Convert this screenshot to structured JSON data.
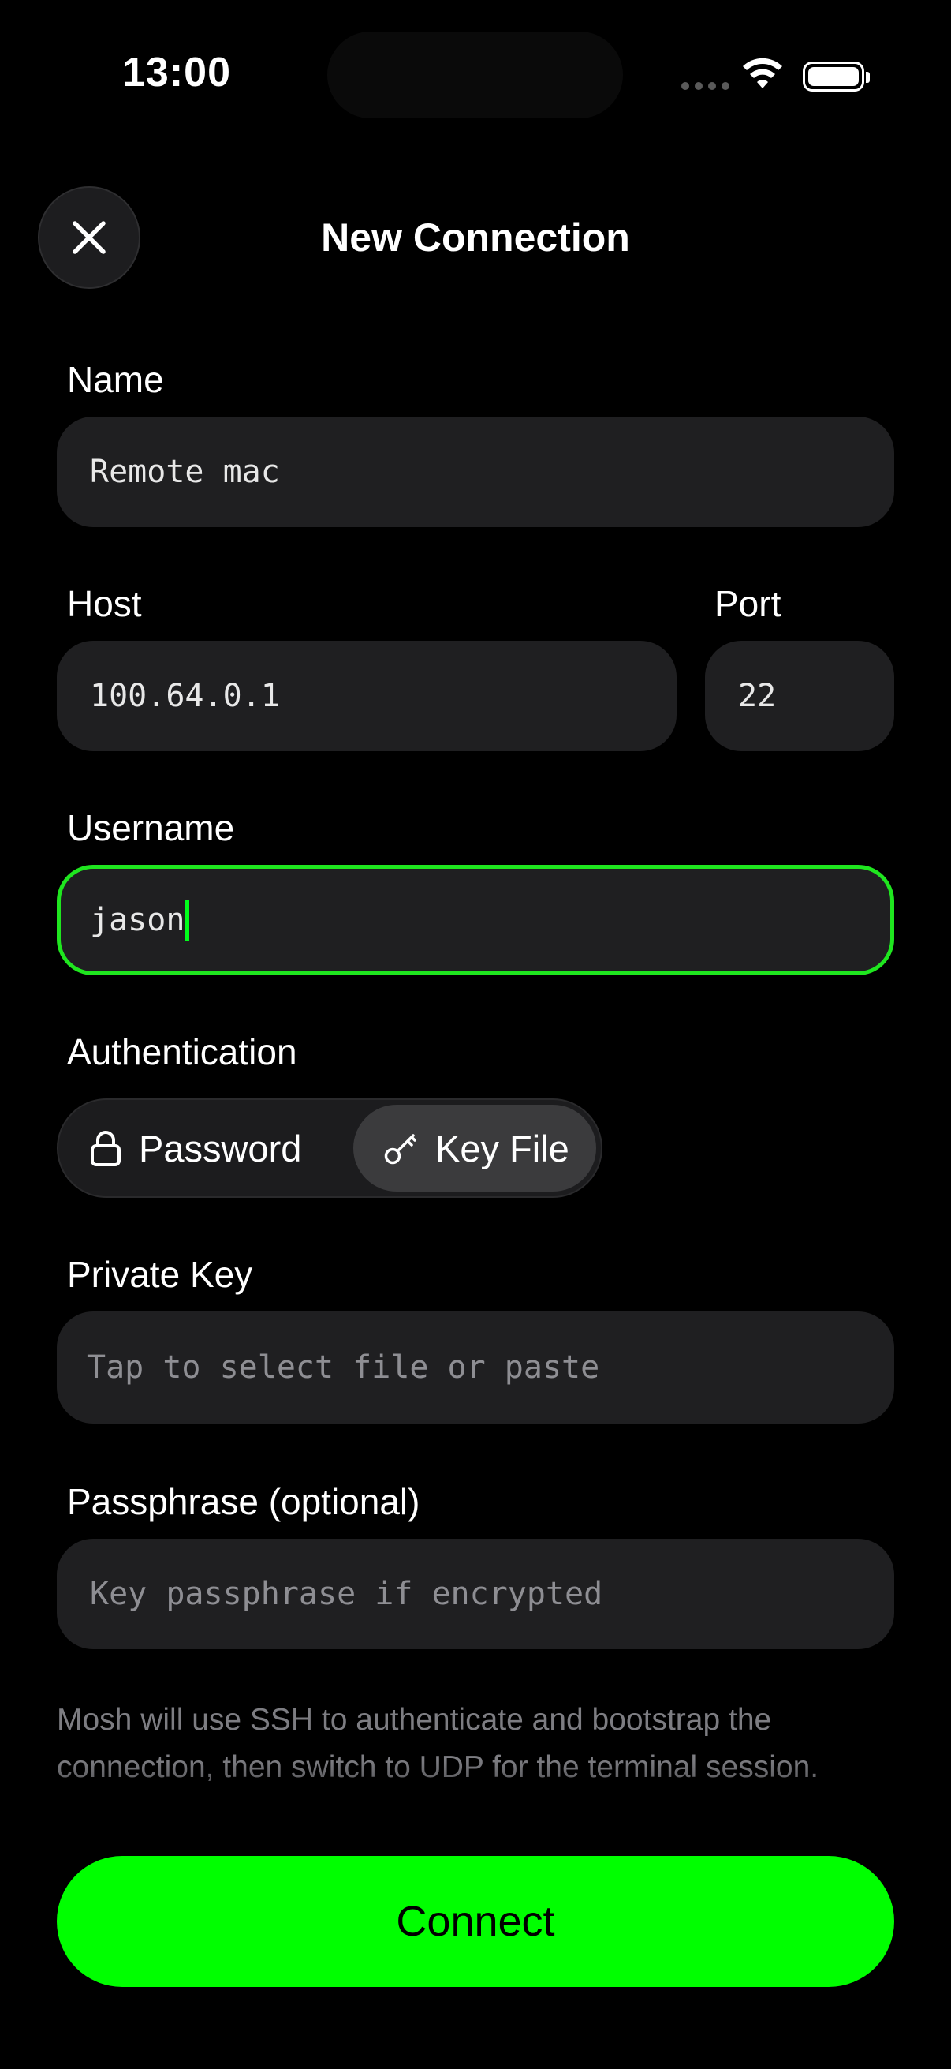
{
  "status_bar": {
    "time": "13:00"
  },
  "header": {
    "title": "New Connection",
    "close_icon": "close-icon"
  },
  "form": {
    "name": {
      "label": "Name",
      "value": "Remote mac"
    },
    "host": {
      "label": "Host",
      "value": "100.64.0.1"
    },
    "port": {
      "label": "Port",
      "value": "22"
    },
    "username": {
      "label": "Username",
      "value": "jason"
    },
    "authentication": {
      "label": "Authentication",
      "options": [
        {
          "label": "Password",
          "icon": "lock-icon",
          "selected": false
        },
        {
          "label": "Key File",
          "icon": "key-icon",
          "selected": true
        }
      ]
    },
    "private_key": {
      "label": "Private Key",
      "placeholder": "Tap to select file or paste"
    },
    "passphrase": {
      "label": "Passphrase (optional)",
      "placeholder": "Key passphrase if encrypted"
    }
  },
  "footnote": "Mosh will use SSH to authenticate and bootstrap the connection, then switch to UDP for the terminal session.",
  "actions": {
    "connect_label": "Connect"
  },
  "colors": {
    "accent": "#00ff00",
    "field_bg": "#1f1f21",
    "background": "#000000"
  }
}
